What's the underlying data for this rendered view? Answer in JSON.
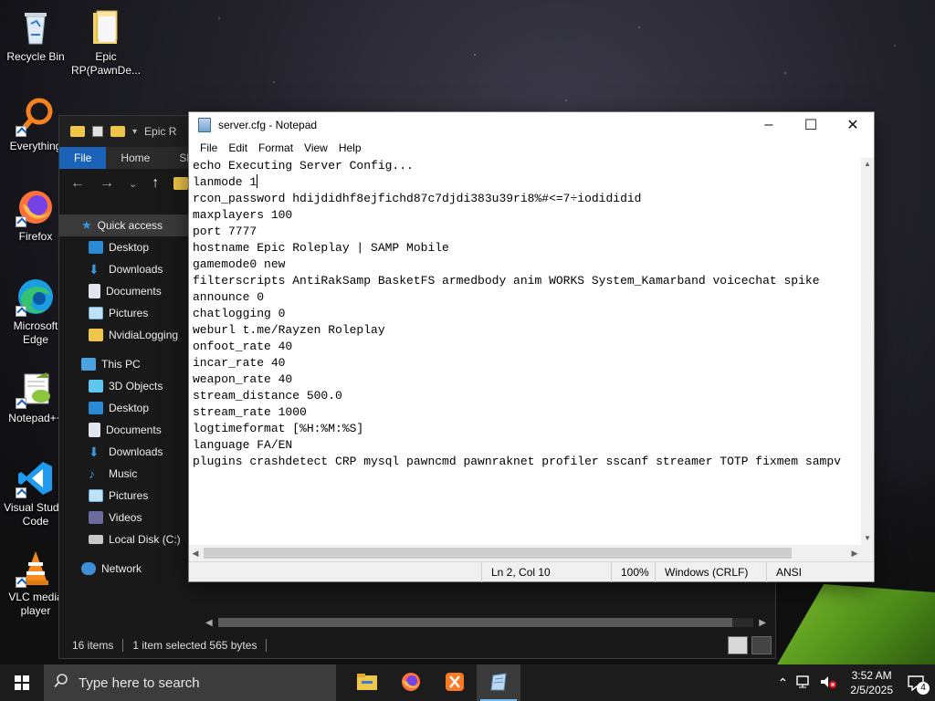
{
  "desktop": {
    "icons": [
      {
        "label": "Recycle Bin",
        "icon": "recycle-bin-icon"
      },
      {
        "label": "Epic RP(PawnDe...",
        "icon": "folder-icon"
      },
      {
        "label": "Everything",
        "icon": "everything-search-icon"
      },
      {
        "label": "Firefox",
        "icon": "firefox-icon"
      },
      {
        "label": "Microsoft Edge",
        "icon": "edge-icon"
      },
      {
        "label": "Notepad++",
        "icon": "notepad-plus-plus-icon"
      },
      {
        "label": "Visual Studio Code",
        "icon": "vscode-icon"
      },
      {
        "label": "VLC media player",
        "icon": "vlc-icon"
      }
    ]
  },
  "explorer": {
    "title": "Epic R",
    "ribbon_tabs": [
      "File",
      "Home",
      "Sh"
    ],
    "nav": {
      "quick_access": "Quick access",
      "quick_items": [
        "Desktop",
        "Downloads",
        "Documents",
        "Pictures",
        "NvidiaLogging"
      ],
      "this_pc": "This PC",
      "pc_items": [
        "3D Objects",
        "Desktop",
        "Documents",
        "Downloads",
        "Music",
        "Pictures",
        "Videos",
        "Local Disk (C:)"
      ],
      "network": "Network"
    },
    "status": {
      "items": "16 items",
      "selected": "1 item selected  565 bytes"
    }
  },
  "notepad": {
    "title": "server.cfg - Notepad",
    "menu": [
      "File",
      "Edit",
      "Format",
      "View",
      "Help"
    ],
    "lines": [
      "echo Executing Server Config...",
      "lanmode 1",
      "rcon_password hdijdidhf8ejfichd87c7djdi383u39ri8%#<=7÷iodididid",
      "maxplayers 100",
      "port 7777",
      "hostname Epic Roleplay | SAMP Mobile",
      "gamemode0 new",
      "filterscripts AntiRakSamp BasketFS armedbody anim WORKS System_Kamarband voicechat spike",
      "announce 0",
      "chatlogging 0",
      "weburl t.me/Rayzen Roleplay",
      "onfoot_rate 40",
      "incar_rate 40",
      "weapon_rate 40",
      "stream_distance 500.0",
      "stream_rate 1000",
      "logtimeformat [%H:%M:%S]",
      "language FA/EN",
      "plugins crashdetect CRP mysql pawncmd pawnraknet profiler sscanf streamer TOTP fixmem sampv"
    ],
    "status": {
      "position": "Ln 2, Col 10",
      "zoom": "100%",
      "line_ending": "Windows (CRLF)",
      "encoding": "ANSI"
    }
  },
  "taskbar": {
    "search_placeholder": "Type here to search",
    "apps": [
      "file-explorer-icon",
      "firefox-icon",
      "xampp-icon",
      "notepad-icon"
    ],
    "time": "3:52 AM",
    "date": "2/5/2025",
    "notification_count": "4"
  }
}
